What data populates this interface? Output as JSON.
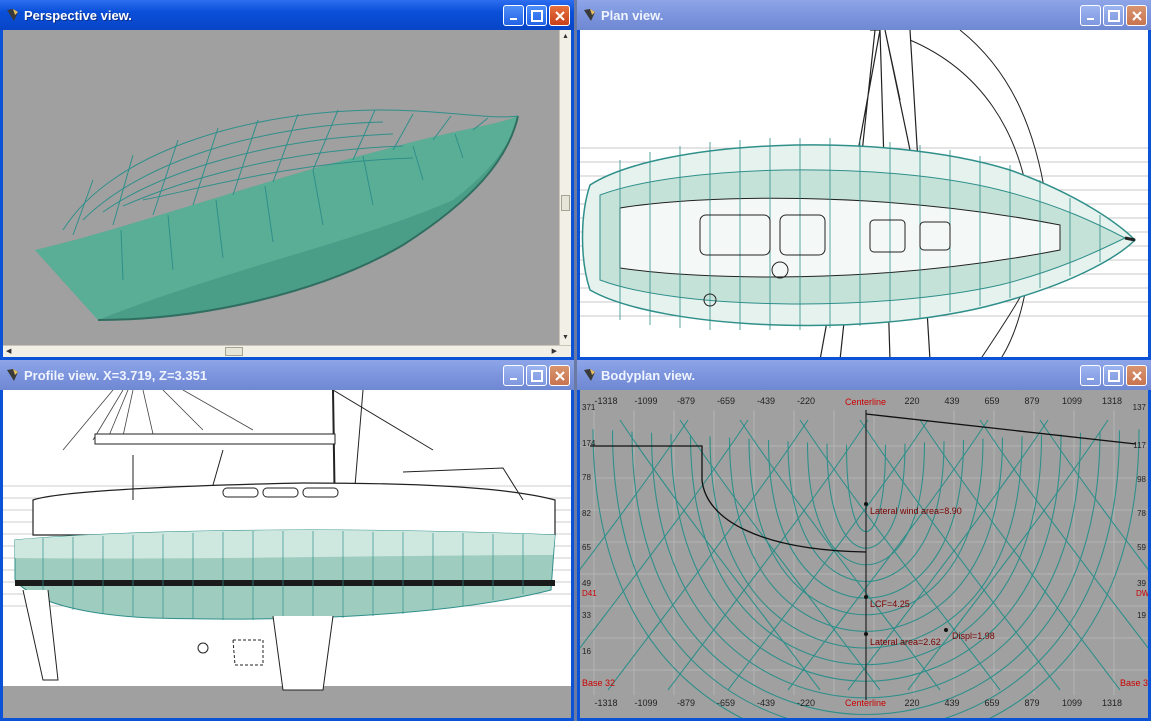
{
  "windows": {
    "perspective": {
      "title": "Perspective view."
    },
    "plan": {
      "title": "Plan view."
    },
    "profile": {
      "title": "Profile view.  X=3.719,  Z=3.351"
    },
    "bodyplan": {
      "title": "Bodyplan view."
    }
  },
  "bodyplan": {
    "centerline_label": "Centerline",
    "ticks_top": [
      "-1318",
      "-1099",
      "-879",
      "-659",
      "-439",
      "-220",
      "220",
      "439",
      "659",
      "879",
      "1099",
      "1318"
    ],
    "ticks_bottom": [
      "-1318",
      "-1099",
      "-879",
      "-659",
      "-439",
      "-220",
      "220",
      "439",
      "659",
      "879",
      "1099",
      "1318"
    ],
    "left_edge_labels": [
      "371",
      "174",
      "78",
      "82",
      "65",
      "49",
      "33",
      "16"
    ],
    "right_edge_labels": [
      "137",
      "117",
      "98",
      "78",
      "59",
      "39",
      "19"
    ],
    "base_left": "Base 32",
    "base_right": "Base 3",
    "dwl_left": "D41",
    "dwl_right": "DW",
    "annotations": {
      "lateral_wind_area": "Lateral wind area=8.90",
      "lcf": "LCF=4.25",
      "lateral_area": "Lateral area=2.62",
      "displ": "Displ=1.98"
    }
  },
  "colors": {
    "hull_green": "#3f9d86",
    "hull_light": "#9ecdbf",
    "grid_teal": "#2f8f8a",
    "label_red": "#cc0000",
    "active_title": "#0a4fd9"
  }
}
